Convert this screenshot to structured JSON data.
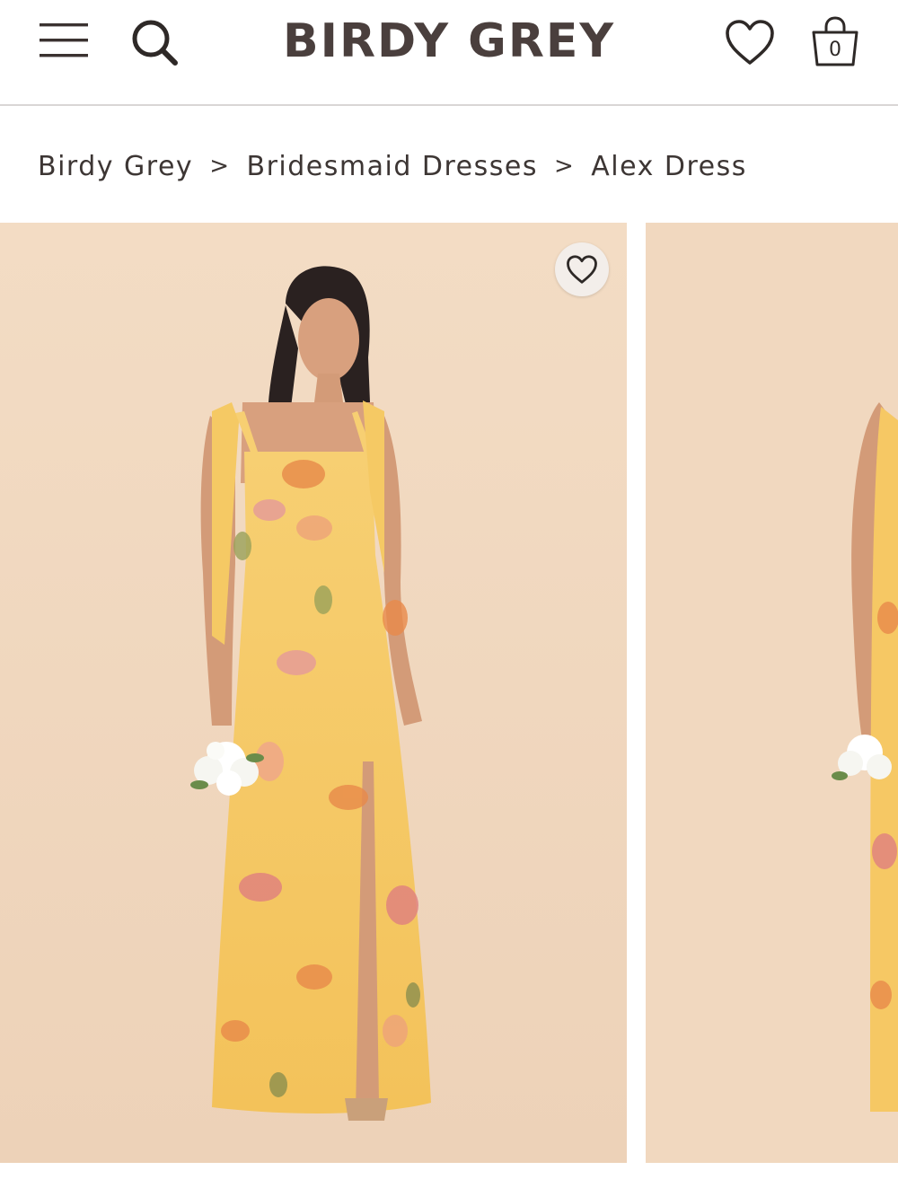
{
  "header": {
    "brand": "BIRDY GREY",
    "cart_count": "0",
    "icons": {
      "menu": "hamburger-menu-icon",
      "search": "search-icon",
      "wishlist": "heart-icon",
      "cart": "shopping-bag-icon"
    }
  },
  "breadcrumb": {
    "items": [
      "Birdy Grey",
      "Bridesmaid Dresses",
      "Alex Dress"
    ],
    "separator": ">"
  },
  "gallery": {
    "slides": [
      {
        "subject": "model-wearing-yellow-floral-dress",
        "background": "#f1d8bf"
      },
      {
        "subject": "model-wearing-yellow-floral-dress-partial",
        "background": "#f1d8bf"
      }
    ],
    "favorite_icon": "heart-icon"
  },
  "colors": {
    "brand_text": "#4a3f3d",
    "photo_background": "#f1d8bf",
    "dress_yellow": "#f6cd6b",
    "floral_orange": "#e88a4a",
    "floral_pink": "#e59a9a"
  }
}
